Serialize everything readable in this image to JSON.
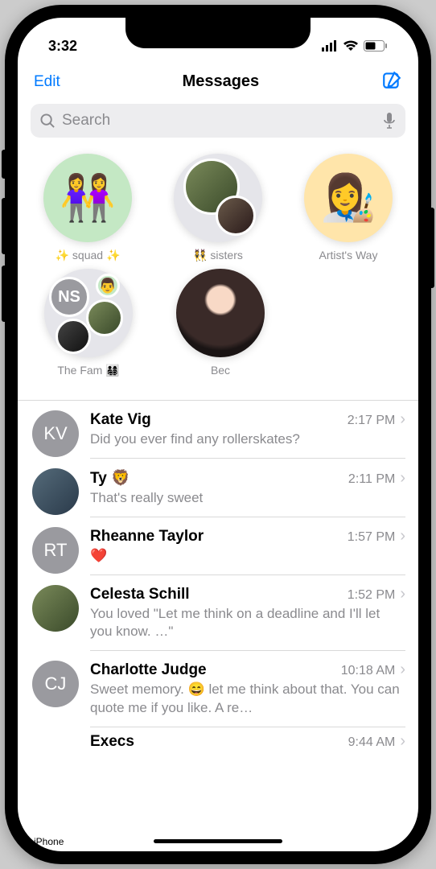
{
  "status": {
    "time": "3:32"
  },
  "nav": {
    "edit": "Edit",
    "title": "Messages"
  },
  "search": {
    "placeholder": "Search"
  },
  "pinned": [
    {
      "label": "✨ squad ✨",
      "style": "green",
      "emoji": "👭"
    },
    {
      "label": "👯 sisters",
      "style": "group-photos"
    },
    {
      "label": "Artist's Way",
      "style": "yellow",
      "emoji": "👩‍🎨"
    },
    {
      "label": "The Fam 👨‍👩‍👧‍👦",
      "style": "fam-group",
      "initials": "NS"
    },
    {
      "label": "Bec",
      "style": "photo"
    }
  ],
  "conversations": [
    {
      "name": "Kate Vig",
      "time": "2:17 PM",
      "preview": "Did you ever find any rollerskates?",
      "avatar": {
        "type": "initials",
        "text": "KV",
        "bg": "#9a9a9f"
      }
    },
    {
      "name": "Ty 🦁",
      "time": "2:11 PM",
      "preview": "That's really sweet",
      "avatar": {
        "type": "photo"
      }
    },
    {
      "name": "Rheanne Taylor",
      "time": "1:57 PM",
      "preview": "❤️",
      "avatar": {
        "type": "initials",
        "text": "RT",
        "bg": "#9a9a9f"
      }
    },
    {
      "name": "Celesta Schill",
      "time": "1:52 PM",
      "preview": "You loved \"Let me think on a deadline and I'll let you know. …\"",
      "avatar": {
        "type": "photo2"
      }
    },
    {
      "name": "Charlotte Judge",
      "time": "10:18 AM",
      "preview": "Sweet memory. 😄 let me think about that. You can quote me if you like. A re…",
      "avatar": {
        "type": "initials",
        "text": "CJ",
        "bg": "#9a9a9f"
      }
    },
    {
      "name": "Execs",
      "time": "9:44 AM",
      "preview": "",
      "avatar": {
        "type": "hidden"
      }
    }
  ],
  "watermark": "iPhone"
}
